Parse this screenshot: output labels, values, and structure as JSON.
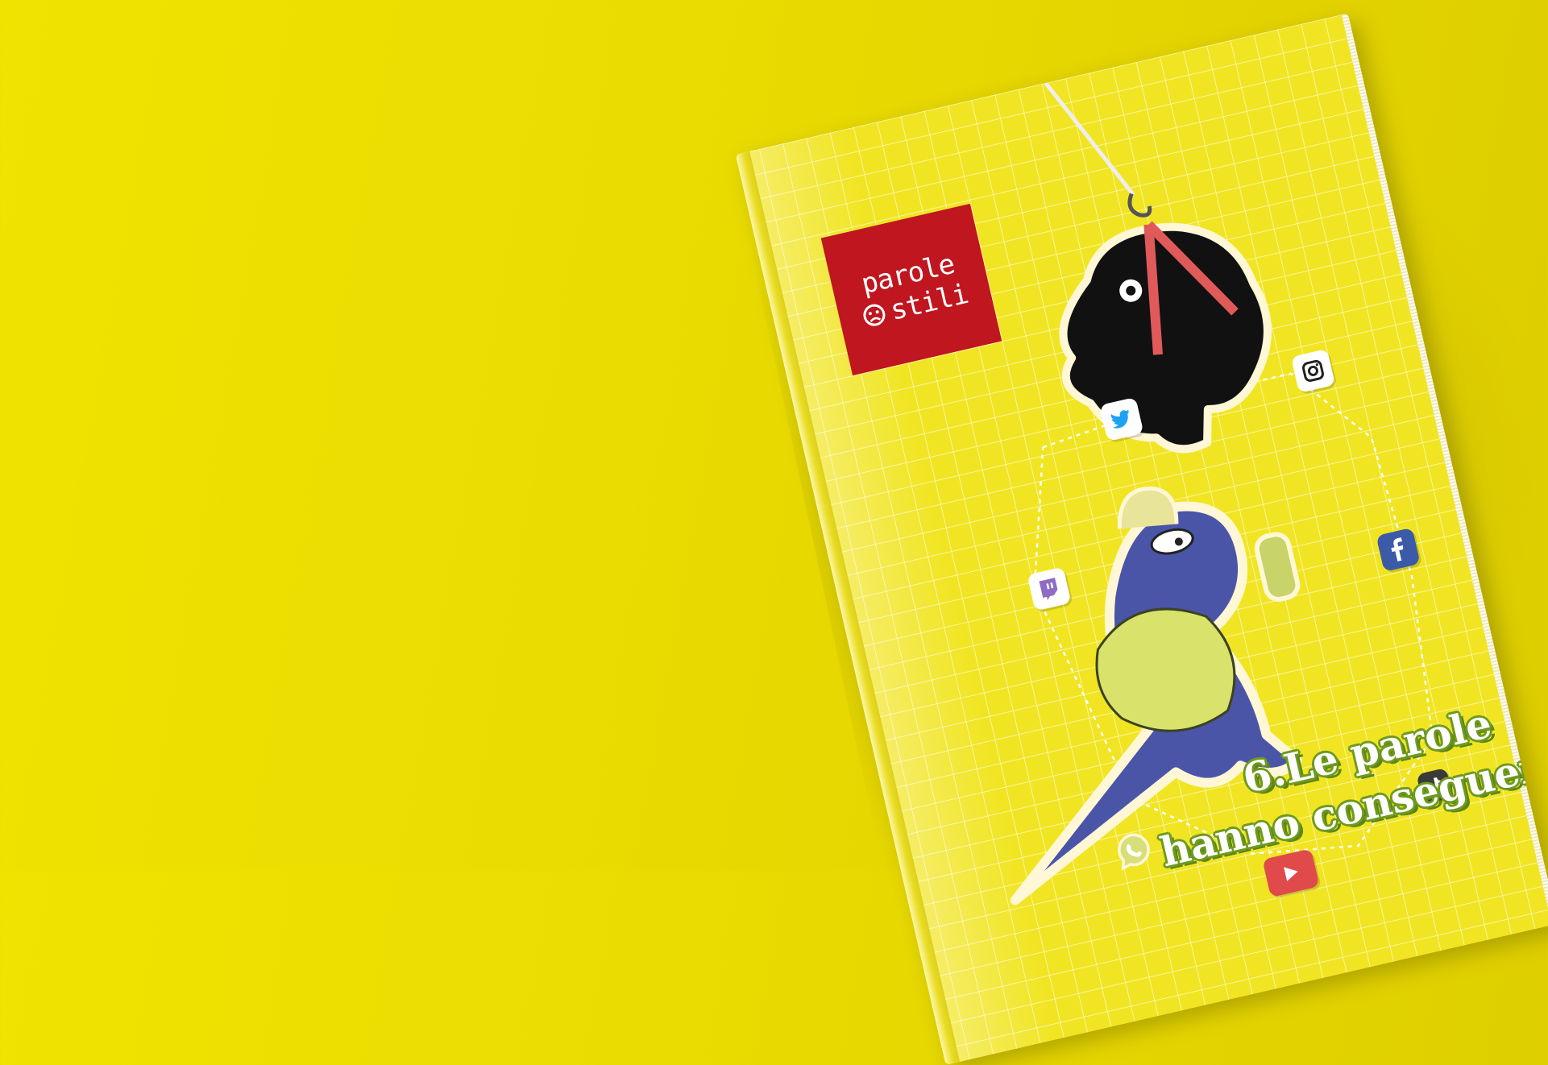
{
  "book": {
    "logo": {
      "line1": "parole",
      "line2": "stili",
      "color": "#c0161f"
    },
    "title_line1": "6.Le parole",
    "title_line2": "hanno conseguenze",
    "title_outline_color": "#6e9a1e"
  },
  "icons": [
    "twitter-icon",
    "instagram-icon",
    "twitch-icon",
    "facebook-icon",
    "whatsapp-icon",
    "youtube-icon",
    "tiktok-icon"
  ],
  "colors": {
    "background": "#eadc00",
    "cover": "#f1e523",
    "dino": "#4b55a8",
    "monster": "#111111"
  }
}
